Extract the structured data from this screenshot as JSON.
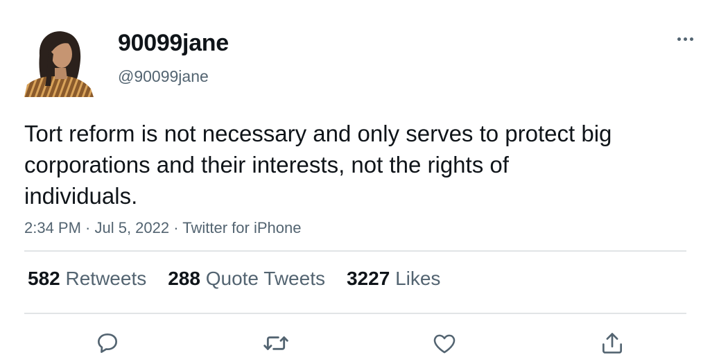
{
  "tweet": {
    "author": {
      "display_name": "90099jane",
      "handle": "@90099jane",
      "avatar_icon": "profile-photo"
    },
    "text": "Tort reform is not necessary and only serves to protect big corporations and their interests, not the rights of individuals.",
    "meta": "2:34 PM · Jul 5, 2022 · Twitter for iPhone",
    "stats": {
      "retweets": {
        "count": "582",
        "label": "Retweets"
      },
      "quote_tweets": {
        "count": "288",
        "label": "Quote Tweets"
      },
      "likes": {
        "count": "3227",
        "label": "Likes"
      }
    },
    "actions": [
      "reply-icon",
      "retweet-icon",
      "like-icon",
      "share-icon"
    ],
    "more_icon": "more-icon"
  },
  "colors": {
    "text_primary": "#0f1419",
    "text_secondary": "#536471",
    "divider": "#e1e4e6",
    "background": "#ffffff"
  }
}
